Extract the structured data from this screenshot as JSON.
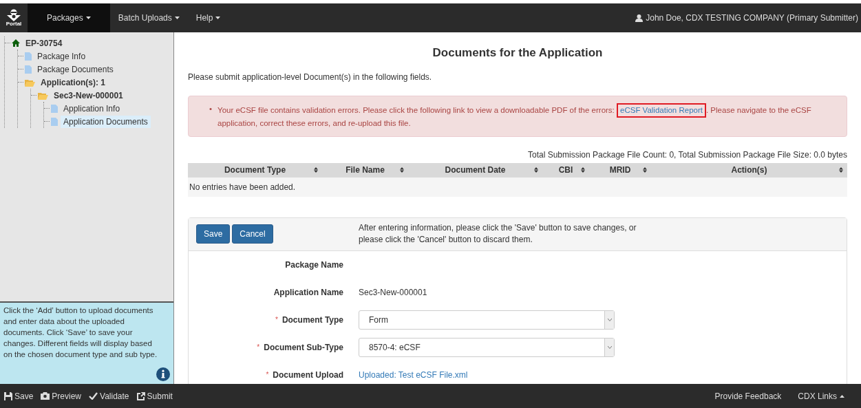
{
  "navbar": {
    "logo_text": "Portal",
    "menus": [
      {
        "label": "Packages",
        "selected": true
      },
      {
        "label": "Batch Uploads",
        "selected": false
      },
      {
        "label": "Help",
        "selected": false
      }
    ],
    "user": "John Doe, CDX TESTING COMPANY (Primary Submitter)"
  },
  "sidebar": {
    "tree": [
      {
        "label": "EP-30754",
        "kind": "home",
        "bold": true,
        "selected": false,
        "children": [
          {
            "label": "Package Info",
            "kind": "file",
            "bold": false,
            "selected": false
          },
          {
            "label": "Package Documents",
            "kind": "file",
            "bold": false,
            "selected": false
          },
          {
            "label": "Application(s): 1",
            "kind": "folder",
            "bold": true,
            "selected": false,
            "children": [
              {
                "label": "Sec3-New-000001",
                "kind": "folder",
                "bold": true,
                "selected": false,
                "children": [
                  {
                    "label": "Application Info",
                    "kind": "file",
                    "bold": false,
                    "selected": false
                  },
                  {
                    "label": "Application Documents",
                    "kind": "file",
                    "bold": false,
                    "selected": true
                  }
                ]
              }
            ]
          }
        ]
      }
    ],
    "help_text": "Click the ‘Add’ button to upload documents and enter data about the uploaded documents. Click ‘Save’ to save your changes. Different fields will display based on the chosen document type and sub type."
  },
  "main": {
    "title": "Documents for the Application",
    "intro": "Please submit application-level Document(s) in the following fields.",
    "alert": {
      "bullet": "•",
      "before": "Your eCSF file contains validation errors. Please click the following link to view a downloadable PDF of the errors:",
      "link": "eCSF Validation Report",
      "after": ". Please navigate to the eCSF application, correct these errors, and re-upload this file.",
      "link_highlighted": true
    },
    "totals": "Total Submission Package File Count: 0, Total Submission Package File Size: 0.0 bytes",
    "table": {
      "columns": [
        "Document Type",
        "File Name",
        "Document Date",
        "CBI",
        "MRID",
        "Action(s)"
      ],
      "empty_text": "No entries have been added."
    },
    "form": {
      "buttons": [
        "Save",
        "Cancel"
      ],
      "instructions": "After entering information, please click the 'Save' button to save changes, or please click the 'Cancel' button to discard them.",
      "fields": [
        {
          "label": "Package Name",
          "kind": "text"
        },
        {
          "label": "Application Name",
          "kind": "text",
          "value": "Sec3-New-000001"
        },
        {
          "label": "Document Type",
          "required_mark": "*",
          "kind": "select",
          "value": "Form"
        },
        {
          "label": "Document Sub-Type",
          "required_mark": "*",
          "kind": "select",
          "value": "8570-4: eCSF"
        },
        {
          "label": "Document Upload",
          "required_mark": "*",
          "kind": "link",
          "value": "Uploaded: Test eCSF File.xml"
        }
      ]
    }
  },
  "footer": {
    "actions": [
      {
        "label": "Save",
        "kind": "save"
      },
      {
        "label": "Preview",
        "kind": "preview"
      },
      {
        "label": "Validate",
        "kind": "validate"
      },
      {
        "label": "Submit",
        "kind": "submit"
      }
    ],
    "links": [
      "Provide Feedback",
      "CDX Links"
    ]
  }
}
